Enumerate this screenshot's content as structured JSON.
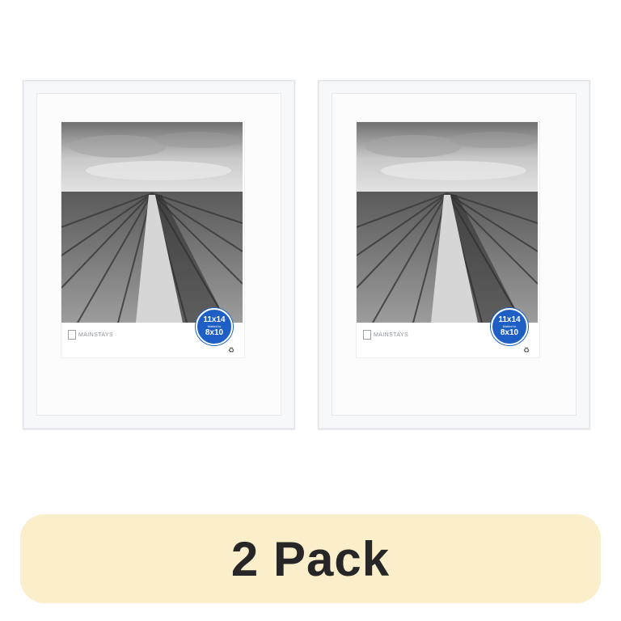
{
  "products": [
    {
      "brand": "MAINSTAYS",
      "badge": {
        "size": "11x14",
        "matted_to": "Matted to",
        "inner_size": "8x10"
      },
      "recycle_symbol": "♻"
    },
    {
      "brand": "MAINSTAYS",
      "badge": {
        "size": "11x14",
        "matted_to": "Matted to",
        "inner_size": "8x10"
      },
      "recycle_symbol": "♻"
    }
  ],
  "pack_label": "2 Pack",
  "colors": {
    "badge": "#1d5fc4",
    "banner": "#fbeecb",
    "frame": "#f7f8fa"
  }
}
